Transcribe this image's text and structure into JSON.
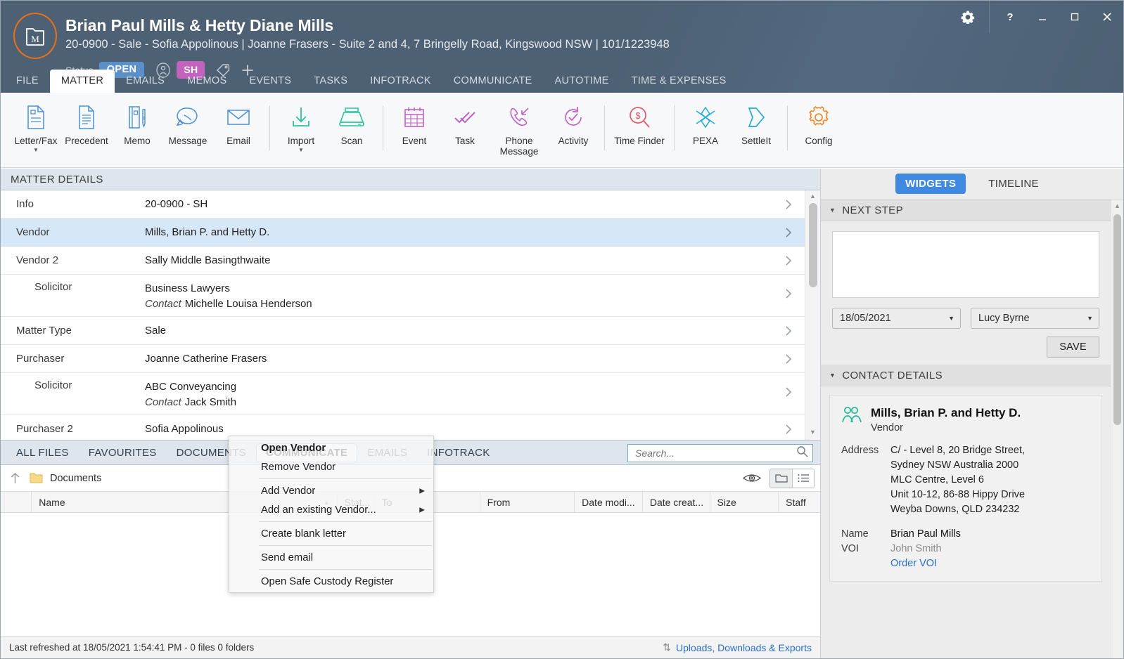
{
  "header": {
    "title": "Brian Paul Mills & Hetty Diane Mills",
    "subtitle": "20-0900 - Sale - Sofia Appolinous | Joanne Frasers - Suite 2 and 4, 7 Bringelly Road, Kingswood NSW | 101/1223948",
    "status_label": "Status",
    "status_value": "OPEN",
    "initials": "SH",
    "accent_orange": "#e8701a",
    "status_blue": "#5b8fca",
    "initials_pink": "#c264bd",
    "bar_color": "#4d6074"
  },
  "tabs": [
    {
      "label": "FILE",
      "active": false
    },
    {
      "label": "MATTER",
      "active": true
    },
    {
      "label": "EMAILS",
      "active": false
    },
    {
      "label": "MEMOS",
      "active": false
    },
    {
      "label": "EVENTS",
      "active": false
    },
    {
      "label": "TASKS",
      "active": false
    },
    {
      "label": "INFOTRACK",
      "active": false
    },
    {
      "label": "COMMUNICATE",
      "active": false
    },
    {
      "label": "AUTOTIME",
      "active": false
    },
    {
      "label": "TIME & EXPENSES",
      "active": false
    }
  ],
  "ribbon": [
    {
      "label": "Letter/Fax",
      "icon": "letter-fax-icon",
      "caret": true,
      "color": "#4a90d9"
    },
    {
      "label": "Precedent",
      "icon": "precedent-icon",
      "caret": false,
      "color": "#4a90d9"
    },
    {
      "label": "Memo",
      "icon": "memo-icon",
      "caret": false,
      "color": "#4a90d9"
    },
    {
      "label": "Message",
      "icon": "message-icon",
      "caret": false,
      "color": "#4a90d9"
    },
    {
      "label": "Email",
      "icon": "email-icon",
      "caret": false,
      "color": "#4a90d9"
    },
    {
      "label": "Import",
      "icon": "import-icon",
      "caret": true,
      "color": "#2bc49a"
    },
    {
      "label": "Scan",
      "icon": "scan-icon",
      "caret": false,
      "color": "#2bc49a"
    },
    {
      "label": "Event",
      "icon": "event-calendar-icon",
      "caret": false,
      "color": "#c061c6"
    },
    {
      "label": "Task",
      "icon": "task-check-icon",
      "caret": false,
      "color": "#c061c6"
    },
    {
      "label": "Phone Message",
      "icon": "phone-message-icon",
      "caret": false,
      "color": "#c061c6"
    },
    {
      "label": "Activity",
      "icon": "activity-icon",
      "caret": false,
      "color": "#c061c6"
    },
    {
      "label": "Time Finder",
      "icon": "time-finder-icon",
      "caret": false,
      "color": "#e0586a"
    },
    {
      "label": "PEXA",
      "icon": "pexa-icon",
      "caret": false,
      "color": "#22a9d4"
    },
    {
      "label": "SettleIt",
      "icon": "settleit-icon",
      "caret": false,
      "color": "#22a9d4"
    },
    {
      "label": "Config",
      "icon": "config-gear-icon",
      "caret": false,
      "color": "#f0821e"
    }
  ],
  "matter_details": {
    "header": "MATTER DETAILS",
    "rows": [
      {
        "label": "Info",
        "indent": false,
        "value": "20-0900 - SH",
        "contact": "",
        "selected": false,
        "tall": false
      },
      {
        "label": "Vendor",
        "indent": false,
        "value": "Mills, Brian P. and Hetty D.",
        "contact": "",
        "selected": true,
        "tall": false
      },
      {
        "label": "Vendor 2",
        "indent": false,
        "value": "Sally Middle Basingthwaite",
        "contact": "",
        "selected": false,
        "tall": false
      },
      {
        "label": "Solicitor",
        "indent": true,
        "value": "Business Lawyers",
        "contact_label": "Contact",
        "contact": "Michelle Louisa Henderson",
        "selected": false,
        "tall": true
      },
      {
        "label": "Matter Type",
        "indent": false,
        "value": "Sale",
        "contact": "",
        "selected": false,
        "tall": false
      },
      {
        "label": "Purchaser",
        "indent": false,
        "value": "Joanne Catherine Frasers",
        "contact": "",
        "selected": false,
        "tall": false
      },
      {
        "label": "Solicitor",
        "indent": true,
        "value": "ABC Conveyancing",
        "contact_label": "Contact",
        "contact": "Jack Smith",
        "selected": false,
        "tall": true
      },
      {
        "label": "Purchaser 2",
        "indent": false,
        "value": "Sofia Appolinous",
        "contact": "",
        "selected": false,
        "tall": false
      }
    ]
  },
  "context_menu": {
    "items": [
      {
        "label": "Open Vendor",
        "bold": true,
        "submenu": false,
        "separator_after": false
      },
      {
        "label": "Remove Vendor",
        "bold": false,
        "submenu": false,
        "separator_after": true
      },
      {
        "label": "Add Vendor",
        "bold": false,
        "submenu": true,
        "separator_after": false
      },
      {
        "label": "Add an existing Vendor...",
        "bold": false,
        "submenu": true,
        "separator_after": true
      },
      {
        "label": "Create blank letter",
        "bold": false,
        "submenu": false,
        "separator_after": true
      },
      {
        "label": "Send email",
        "bold": false,
        "submenu": false,
        "separator_after": true
      },
      {
        "label": "Open Safe Custody Register",
        "bold": false,
        "submenu": false,
        "separator_after": false
      }
    ]
  },
  "files_panel": {
    "tabs": [
      {
        "label": "ALL FILES",
        "active": false
      },
      {
        "label": "FAVOURITES",
        "active": false
      },
      {
        "label": "DOCUMENTS",
        "active": false
      },
      {
        "label": "COMMUNICATE",
        "active": true
      },
      {
        "label": "EMAILS",
        "active": false
      },
      {
        "label": "INFOTRACK",
        "active": false
      }
    ],
    "search_placeholder": "Search...",
    "search_value": "",
    "breadcrumb": "Documents",
    "columns": [
      {
        "label": "Name",
        "key": "name"
      },
      {
        "label": "Stat...",
        "key": "stat"
      },
      {
        "label": "To",
        "key": "to"
      },
      {
        "label": "From",
        "key": "from"
      },
      {
        "label": "Date modi...",
        "key": "dmod"
      },
      {
        "label": "Date creat...",
        "key": "dcre"
      },
      {
        "label": "Size",
        "key": "size"
      },
      {
        "label": "Staff",
        "key": "staff"
      }
    ],
    "rows": []
  },
  "statusbar": {
    "text": "Last refreshed at 18/05/2021 1:54:41 PM  -  0 files 0 folders",
    "link": "Uploads, Downloads & Exports"
  },
  "right_panel": {
    "tabs": [
      {
        "label": "WIDGETS",
        "active": true
      },
      {
        "label": "TIMELINE",
        "active": false
      }
    ],
    "next_step": {
      "title": "NEXT STEP",
      "note_value": "",
      "date_value": "18/05/2021",
      "staff_value": "Lucy Byrne",
      "save_label": "SAVE"
    },
    "contact_details": {
      "title": "CONTACT DETAILS",
      "name": "Mills, Brian P. and Hetty D.",
      "role": "Vendor",
      "address_label": "Address",
      "address_lines": [
        "C/ - Level 8, 20 Bridge Street,",
        "Sydney NSW Australia 2000",
        "MLC Centre, Level 6",
        "Unit 10-12, 86-88 Hippy Drive",
        "Weyba Downs, QLD 234232"
      ],
      "name_label": "Name",
      "name_value": "Brian Paul Mills",
      "voi_label": "VOI",
      "voi_value": "John Smith",
      "voi_link": "Order VOI"
    }
  }
}
